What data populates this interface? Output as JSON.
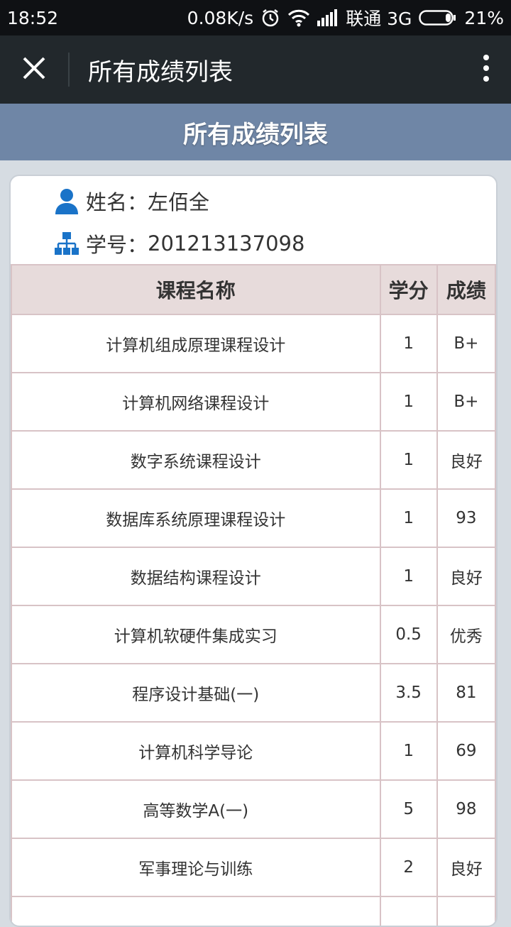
{
  "status_bar": {
    "time": "18:52",
    "speed": "0.08K/s",
    "carrier": "联通 3G",
    "battery": "21%",
    "icons": [
      "alarm-icon",
      "wifi-icon",
      "signal-icon",
      "battery-icon"
    ]
  },
  "app_bar": {
    "title": "所有成绩列表",
    "icons": [
      "close-icon",
      "more-vert-icon"
    ]
  },
  "page_header": {
    "title": "所有成绩列表"
  },
  "student": {
    "name_label": "姓名：",
    "name_value": "左佰全",
    "id_label": "学号：",
    "id_value": "201213137098",
    "icons": [
      "person-icon",
      "network-icon"
    ]
  },
  "table": {
    "headers": [
      "课程名称",
      "学分",
      "成绩"
    ],
    "rows": [
      {
        "course": "计算机组成原理课程设计",
        "credit": "1",
        "grade": "B+"
      },
      {
        "course": "计算机网络课程设计",
        "credit": "1",
        "grade": "B+"
      },
      {
        "course": "数字系统课程设计",
        "credit": "1",
        "grade": "良好"
      },
      {
        "course": "数据库系统原理课程设计",
        "credit": "1",
        "grade": "93"
      },
      {
        "course": "数据结构课程设计",
        "credit": "1",
        "grade": "良好"
      },
      {
        "course": "计算机软硬件集成实习",
        "credit": "0.5",
        "grade": "优秀"
      },
      {
        "course": "程序设计基础(一)",
        "credit": "3.5",
        "grade": "81"
      },
      {
        "course": "计算机科学导论",
        "credit": "1",
        "grade": "69"
      },
      {
        "course": "高等数学A(一)",
        "credit": "5",
        "grade": "98"
      },
      {
        "course": "军事理论与训练",
        "credit": "2",
        "grade": "良好"
      },
      {
        "course": "",
        "credit": "",
        "grade": ""
      }
    ]
  },
  "colors": {
    "status_bar": "#0f1114",
    "app_bar": "#22282c",
    "page_header": "#6f86a6",
    "table_header": "#e7dbdb",
    "icon_blue": "#1a73c8"
  }
}
